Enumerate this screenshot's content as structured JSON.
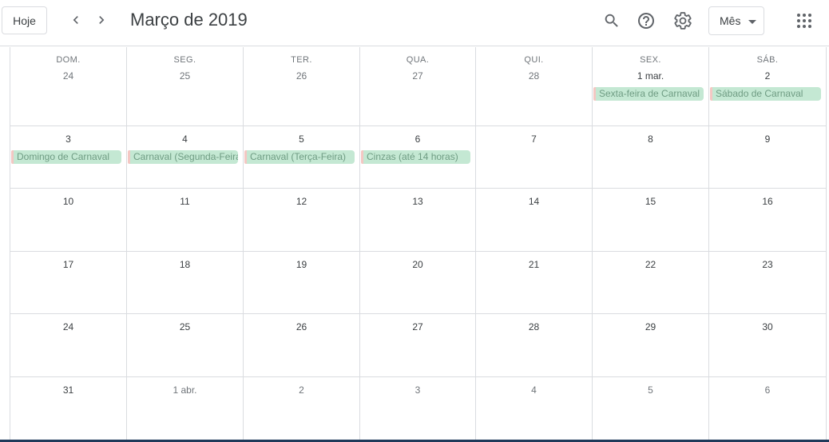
{
  "header": {
    "today_label": "Hoje",
    "title": "Março de 2019",
    "view_label": "Mês",
    "icons": {
      "prev": "chevron-left-icon",
      "next": "chevron-right-icon",
      "search": "search-icon",
      "help": "help-icon",
      "settings": "gear-icon",
      "apps": "apps-grid-icon"
    }
  },
  "weekdays": [
    "DOM.",
    "SEG.",
    "TER.",
    "QUA.",
    "QUI.",
    "SEX.",
    "SÁB."
  ],
  "weeks": [
    {
      "days": [
        {
          "label": "24",
          "muted": true
        },
        {
          "label": "25",
          "muted": true
        },
        {
          "label": "26",
          "muted": true
        },
        {
          "label": "27",
          "muted": true
        },
        {
          "label": "28",
          "muted": true
        },
        {
          "label": "1 mar.",
          "muted": false,
          "event": "Sexta-feira de Carnaval"
        },
        {
          "label": "2",
          "muted": false,
          "event": "Sábado de Carnaval"
        }
      ]
    },
    {
      "days": [
        {
          "label": "3",
          "event": "Domingo de Carnaval"
        },
        {
          "label": "4",
          "event": "Carnaval (Segunda-Feira)"
        },
        {
          "label": "5",
          "event": "Carnaval (Terça-Feira)"
        },
        {
          "label": "6",
          "event": "Cinzas (até 14 horas)"
        },
        {
          "label": "7"
        },
        {
          "label": "8"
        },
        {
          "label": "9"
        }
      ]
    },
    {
      "days": [
        {
          "label": "10"
        },
        {
          "label": "11"
        },
        {
          "label": "12"
        },
        {
          "label": "13"
        },
        {
          "label": "14"
        },
        {
          "label": "15"
        },
        {
          "label": "16"
        }
      ]
    },
    {
      "days": [
        {
          "label": "17"
        },
        {
          "label": "18"
        },
        {
          "label": "19"
        },
        {
          "label": "20"
        },
        {
          "label": "21"
        },
        {
          "label": "22"
        },
        {
          "label": "23"
        }
      ]
    },
    {
      "days": [
        {
          "label": "24"
        },
        {
          "label": "25"
        },
        {
          "label": "26"
        },
        {
          "label": "27"
        },
        {
          "label": "28"
        },
        {
          "label": "29"
        },
        {
          "label": "30"
        }
      ]
    },
    {
      "days": [
        {
          "label": "31"
        },
        {
          "label": "1 abr.",
          "muted": true
        },
        {
          "label": "2",
          "muted": true
        },
        {
          "label": "3",
          "muted": true
        },
        {
          "label": "4",
          "muted": true
        },
        {
          "label": "5",
          "muted": true
        },
        {
          "label": "6",
          "muted": true
        }
      ]
    }
  ],
  "colors": {
    "event_bg": "#c4e8d3",
    "event_text": "#6f9c83",
    "event_accent": "#f4c7c3",
    "grid_line": "#dadce0"
  }
}
